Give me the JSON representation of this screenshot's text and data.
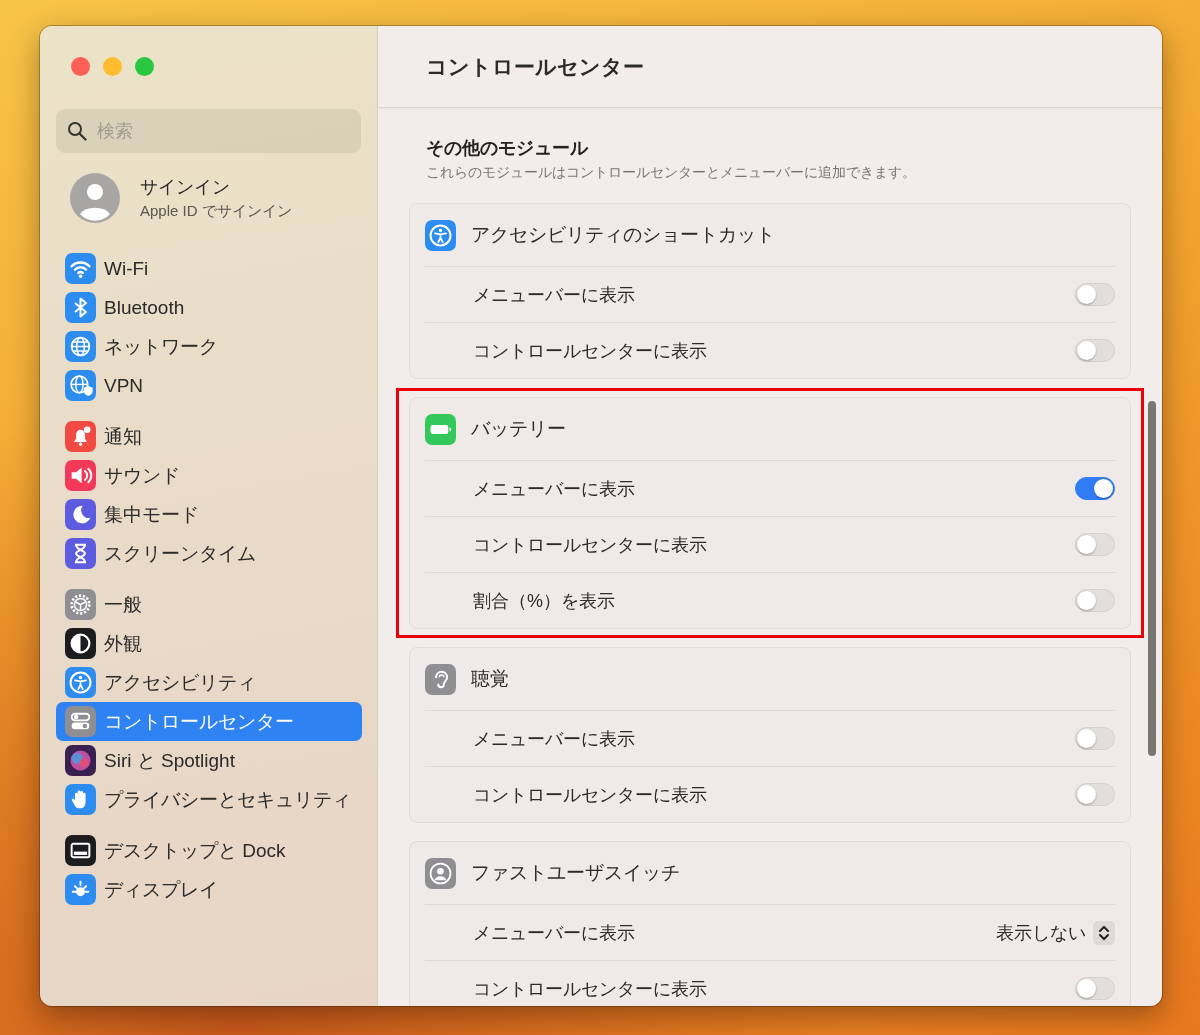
{
  "window": {
    "title": "コントロールセンター"
  },
  "sidebar": {
    "search": {
      "placeholder": "検索"
    },
    "account": {
      "name": "サインイン",
      "subtitle": "Apple ID でサインイン"
    },
    "groups": [
      [
        {
          "label": "Wi-Fi",
          "selected": false
        },
        {
          "label": "Bluetooth",
          "selected": false
        },
        {
          "label": "ネットワーク",
          "selected": false
        },
        {
          "label": "VPN",
          "selected": false
        }
      ],
      [
        {
          "label": "通知",
          "selected": false
        },
        {
          "label": "サウンド",
          "selected": false
        },
        {
          "label": "集中モード",
          "selected": false
        },
        {
          "label": "スクリーンタイム",
          "selected": false
        }
      ],
      [
        {
          "label": "一般",
          "selected": false
        },
        {
          "label": "外観",
          "selected": false
        },
        {
          "label": "アクセシビリティ",
          "selected": false
        },
        {
          "label": "コントロールセンター",
          "selected": true
        },
        {
          "label": "Siri と Spotlight",
          "selected": false
        },
        {
          "label": "プライバシーとセキュリティ",
          "selected": false
        }
      ],
      [
        {
          "label": "デスクトップと Dock",
          "selected": false
        },
        {
          "label": "ディスプレイ",
          "selected": false
        }
      ]
    ]
  },
  "content": {
    "section_title": "その他のモジュール",
    "section_description": "これらのモジュールはコントロールセンターとメニューバーに追加できます。",
    "modules": [
      {
        "title": "アクセシビリティのショートカット",
        "highlighted": false,
        "rows": [
          {
            "kind": "toggle",
            "label": "メニューバーに表示",
            "on": false
          },
          {
            "kind": "toggle",
            "label": "コントロールセンターに表示",
            "on": false
          }
        ]
      },
      {
        "title": "バッテリー",
        "highlighted": true,
        "rows": [
          {
            "kind": "toggle",
            "label": "メニューバーに表示",
            "on": true
          },
          {
            "kind": "toggle",
            "label": "コントロールセンターに表示",
            "on": false
          },
          {
            "kind": "toggle",
            "label": "割合（%）を表示",
            "on": false
          }
        ]
      },
      {
        "title": "聴覚",
        "highlighted": false,
        "rows": [
          {
            "kind": "toggle",
            "label": "メニューバーに表示",
            "on": false
          },
          {
            "kind": "toggle",
            "label": "コントロールセンターに表示",
            "on": false
          }
        ]
      },
      {
        "title": "ファストユーザスイッチ",
        "highlighted": false,
        "rows": [
          {
            "kind": "popup",
            "label": "メニューバーに表示",
            "value": "表示しない"
          },
          {
            "kind": "toggle",
            "label": "コントロールセンターに表示",
            "on": false
          }
        ]
      }
    ]
  }
}
